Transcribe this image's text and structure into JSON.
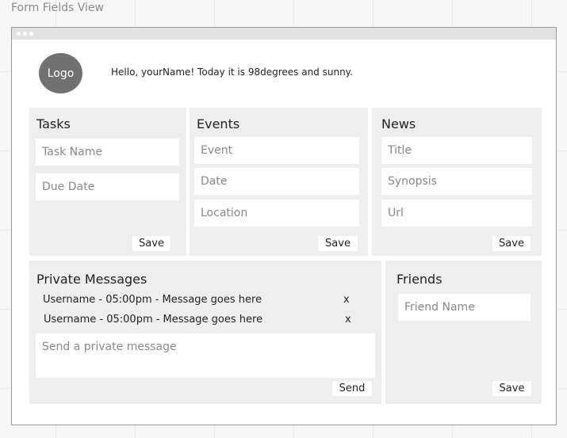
{
  "canvas": {
    "title": "Form Fields View"
  },
  "header": {
    "logo_label": "Logo",
    "greeting": "Hello, yourName!  Today it is 98degrees and sunny."
  },
  "tasks": {
    "title": "Tasks",
    "task_name_placeholder": "Task Name",
    "due_date_placeholder": "Due Date",
    "save_label": "Save"
  },
  "events": {
    "title": "Events",
    "event_placeholder": "Event",
    "date_placeholder": "Date",
    "location_placeholder": "Location",
    "save_label": "Save"
  },
  "news": {
    "title": "News",
    "title_placeholder": "Title",
    "synopsis_placeholder": "Synopsis",
    "url_placeholder": "Url",
    "save_label": "Save"
  },
  "messages": {
    "title": "Private Messages",
    "items": [
      {
        "text": "Username - 05:00pm - Message goes here",
        "remove": "x"
      },
      {
        "text": "Username - 05:00pm - Message goes here",
        "remove": "x"
      }
    ],
    "compose_placeholder": "Send a private message",
    "send_label": "Send"
  },
  "friends": {
    "title": "Friends",
    "friend_name_placeholder": "Friend Name",
    "save_label": "Save"
  }
}
